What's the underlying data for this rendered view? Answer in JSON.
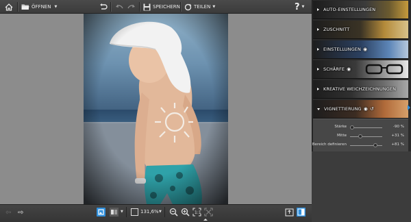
{
  "toolbar": {
    "open_label": "ÖFFNEN",
    "save_label": "SPEICHERN",
    "share_label": "TEILEN",
    "help_label": "?"
  },
  "panel": {
    "sections": [
      {
        "label": "AUTO-EINSTELLUNGEN",
        "expanded": false
      },
      {
        "label": "ZUSCHNITT",
        "expanded": false
      },
      {
        "label": "EINSTELLUNGEN",
        "expanded": false
      },
      {
        "label": "SCHÄRFE",
        "expanded": false
      },
      {
        "label": "KREATIVE WEICHZEICHNUNGEN",
        "expanded": false
      },
      {
        "label": "VIGNETTIERUNG",
        "expanded": true
      }
    ],
    "vignette": {
      "sliders": [
        {
          "name": "Stärke",
          "value_text": "-90 %",
          "value": -90
        },
        {
          "name": "Mitte",
          "value_text": "+31 %",
          "value": 31
        },
        {
          "name": "Bereich definieren",
          "value_text": "+81 %",
          "value": 81
        }
      ]
    }
  },
  "bottombar": {
    "zoom": "131,6%"
  },
  "colors": {
    "accent": "#2f8fdc",
    "panel_bg": "#2b2b2b",
    "canvas_bg": "#8c8c8c"
  },
  "icons": [
    "home-icon",
    "folder-icon",
    "undo-icon",
    "redo-back-icon",
    "redo-icon",
    "save-icon",
    "share-icon",
    "help-icon",
    "eye-icon",
    "reset-icon",
    "prev-icon",
    "next-icon",
    "single-view-icon",
    "compare-view-icon",
    "fit-icon",
    "zoom-out-icon",
    "zoom-in-icon",
    "actual-size-icon",
    "crop-fit-icon",
    "panel-toggle-icon",
    "export-icon"
  ]
}
